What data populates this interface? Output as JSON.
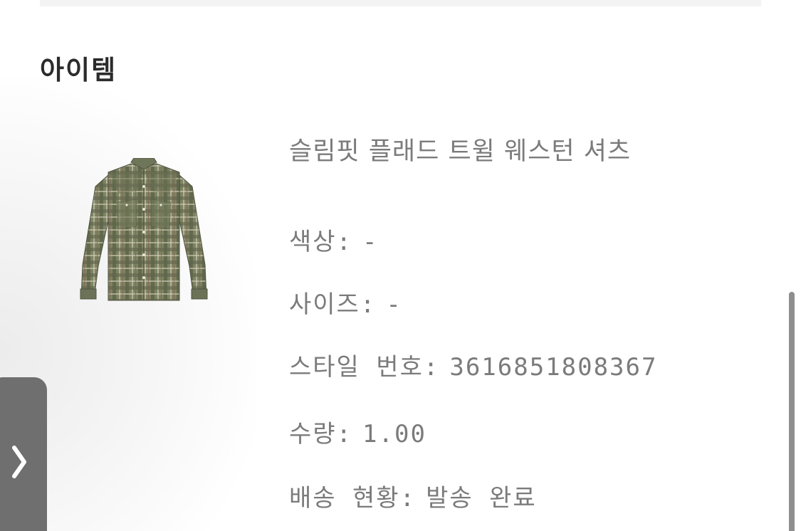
{
  "section": {
    "title": "아이템"
  },
  "item": {
    "image_icon": "plaid-shirt-image",
    "name": "슬림핏 플래드 트윌 웨스턴 셔츠",
    "color_label": "색상:",
    "color_value": "-",
    "size_label": "사이즈:",
    "size_value": "-",
    "style_label": "스타일 번호:",
    "style_value": "3616851808367",
    "qty_label": "수량:",
    "qty_value": "1.00",
    "ship_label": "배송 현황:",
    "ship_value": "발송 완료"
  },
  "side_tab": {
    "icon": "chevron-right-icon"
  },
  "colors": {
    "title_text": "#2b2b2b",
    "detail_text": "#7b7b7b",
    "side_tab": "#6f6f6f",
    "scrollbar": "#8e8e8e"
  }
}
